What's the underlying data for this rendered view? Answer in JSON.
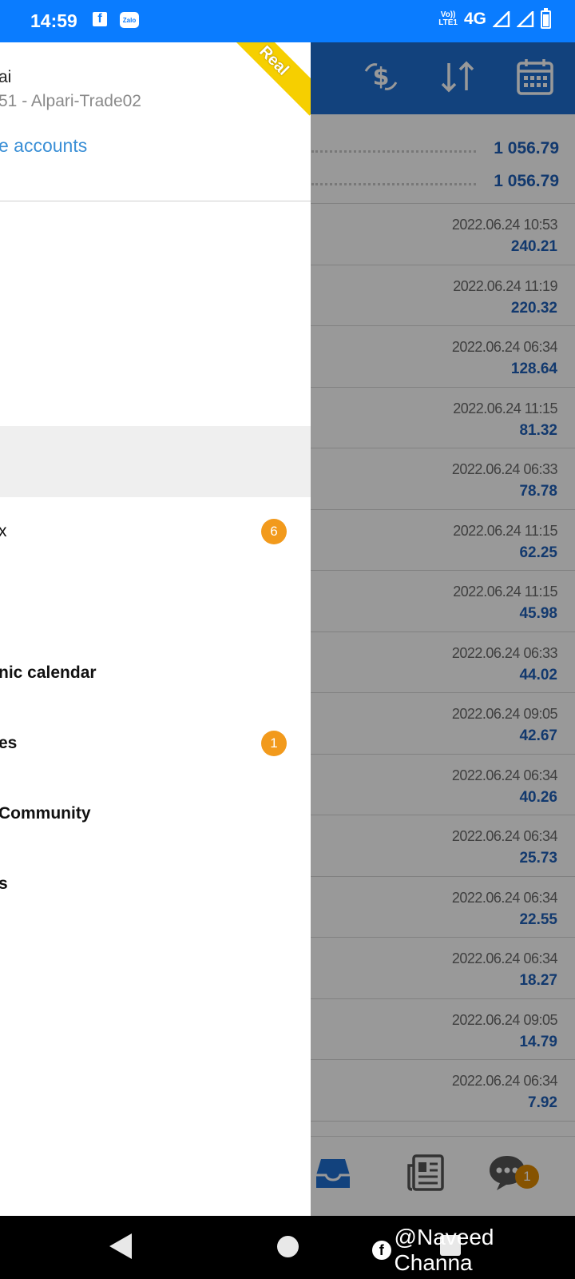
{
  "status_bar": {
    "time": "14:59",
    "network": "4G",
    "volte": "Vo)) LTE1",
    "zalo_label": "Zalo"
  },
  "drawer": {
    "account_name": "ai",
    "account_server": "51 - Alpari-Trade02",
    "manage_accounts": "e accounts",
    "ribbon": "Real",
    "menu_items": [
      {
        "label": "x",
        "badge": "6"
      },
      {
        "label": "nic calendar",
        "badge": null
      },
      {
        "label": "es",
        "badge": "1"
      },
      {
        "label": " Community",
        "badge": null
      },
      {
        "label": "s",
        "badge": null
      }
    ]
  },
  "balances": [
    "1 056.79",
    "1 056.79"
  ],
  "trades": [
    {
      "date": "2022.06.24 10:53",
      "profit": "240.21"
    },
    {
      "date": "2022.06.24 11:19",
      "profit": "220.32"
    },
    {
      "date": "2022.06.24 06:34",
      "profit": "128.64"
    },
    {
      "date": "2022.06.24 11:15",
      "profit": "81.32"
    },
    {
      "date": "2022.06.24 06:33",
      "profit": "78.78"
    },
    {
      "date": "2022.06.24 11:15",
      "profit": "62.25"
    },
    {
      "date": "2022.06.24 11:15",
      "profit": "45.98"
    },
    {
      "date": "2022.06.24 06:33",
      "profit": "44.02"
    },
    {
      "date": "2022.06.24 09:05",
      "profit": "42.67"
    },
    {
      "date": "2022.06.24 06:34",
      "profit": "40.26"
    },
    {
      "date": "2022.06.24 06:34",
      "profit": "25.73"
    },
    {
      "date": "2022.06.24 06:34",
      "profit": "22.55"
    },
    {
      "date": "2022.06.24 06:34",
      "profit": "18.27"
    },
    {
      "date": "2022.06.24 09:05",
      "profit": "14.79"
    },
    {
      "date": "2022.06.24 06:34",
      "profit": "7.92"
    }
  ],
  "bottom_nav": {
    "chat_badge": "1"
  },
  "watermark": "@Naveed Channa",
  "colors": {
    "status_bar": "#0a7cff",
    "toolbar": "#1f6fd1",
    "value_blue": "#1f5fb8",
    "badge_orange": "#f29a1c",
    "ribbon_yellow": "#f6cf00",
    "link_blue": "#3a8fd6"
  }
}
